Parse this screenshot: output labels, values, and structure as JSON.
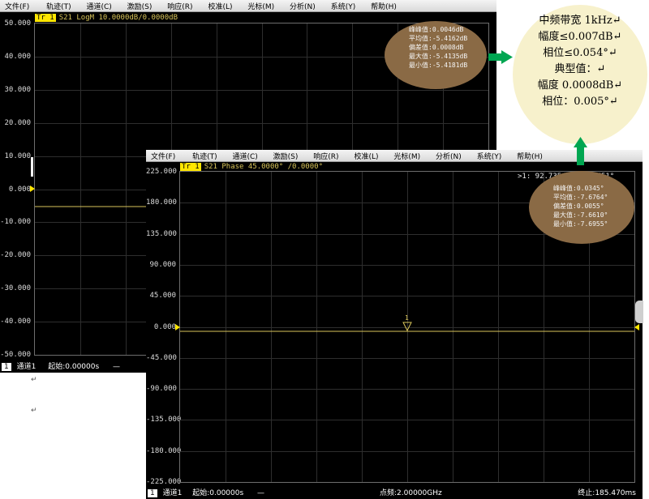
{
  "menu_back": [
    "文件(F)",
    "轨迹(T)",
    "通道(C)",
    "激励(S)",
    "响应(R)",
    "校准(L)",
    "光标(M)",
    "分析(N)",
    "系统(Y)",
    "帮助(H)"
  ],
  "menu_front": [
    "文件(F)",
    "轨迹(T)",
    "通道(C)",
    "激励(S)",
    "响应(R)",
    "校准(L)",
    "光标(M)",
    "分析(N)",
    "系统(Y)",
    "帮助(H)"
  ],
  "back_window": {
    "trace_id": "Tr 1",
    "trace_text": "S21 LogM 10.0000dB/0.0000dB",
    "y_ticks": [
      "50.000",
      "40.000",
      "30.000",
      "20.000",
      "10.000",
      "0.000",
      "-10.000",
      "-20.000",
      "-30.000",
      "-40.000",
      "-50.000"
    ],
    "stats": [
      "峰峰值:0.0046dB",
      "平均值:-5.4162dB",
      "偏差值:0.0008dB",
      "最大值:-5.4135dB",
      "最小值:-5.4181dB"
    ],
    "status": {
      "channel_no": "1",
      "channel": "通道1",
      "start": "起始:0.00000s",
      "dash": "—"
    }
  },
  "front_window": {
    "trace_id": "Tr 1",
    "trace_text": "S21 Phase 45.0000° /0.0000°",
    "y_ticks": [
      "225.000",
      "180.000",
      "135.000",
      "90.000",
      "45.000",
      "0.000",
      "-45.000",
      "-90.000",
      "-135.000",
      "-180.000",
      "-225.000"
    ],
    "marker_readout": ">1:  92.7354ms  -7.6751°",
    "marker_label": "1",
    "stats": [
      "峰峰值:0.0345°",
      "平均值:-7.6764°",
      "偏差值:0.0055°",
      "最大值:-7.6610°",
      "最小值:-7.6955°"
    ],
    "status": {
      "channel_no": "1",
      "channel": "通道1",
      "start": "起始:0.00000s",
      "dash": "—",
      "center": "点频:2.00000GHz",
      "stop": "终止:185.470ms"
    }
  },
  "annotation": {
    "lines": [
      "中频带宽 1kHz↵",
      "幅度≤0.007dB↵",
      "相位≤0.054°↵",
      "典型值：↵",
      "幅度 0.0008dB↵",
      "相位：0.005°↵"
    ],
    "accent": "#00a651",
    "background": "#f7f1cc"
  },
  "paragraph_marks": [
    "↵",
    "↵"
  ],
  "colors": {
    "trace": "#d9c55a",
    "stats_bg": "#8a6a45",
    "grid": "#2e2e2e"
  }
}
